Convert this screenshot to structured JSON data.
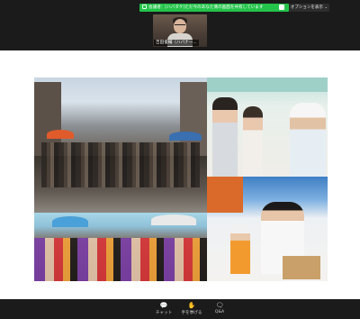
{
  "top_bar": {
    "share_banner": "会議者：[ハバタケ]ただ今のあなた側の画面を共有しています",
    "options_label": "オプションを表示 ⌄"
  },
  "video": {
    "participant_name": "吉田俊輔（ハバナー..."
  },
  "toolbar": {
    "chat_label": "チャット",
    "raise_hand_label": "手を挙げる",
    "qa_label": "Q&A"
  },
  "colors": {
    "banner_green": "#24c34a",
    "toolbar_bg": "#1b1b1b"
  },
  "icons": {
    "chat": "chat-bubble-icon",
    "raise_hand": "hand-icon",
    "qa": "qa-bubble-icon"
  }
}
